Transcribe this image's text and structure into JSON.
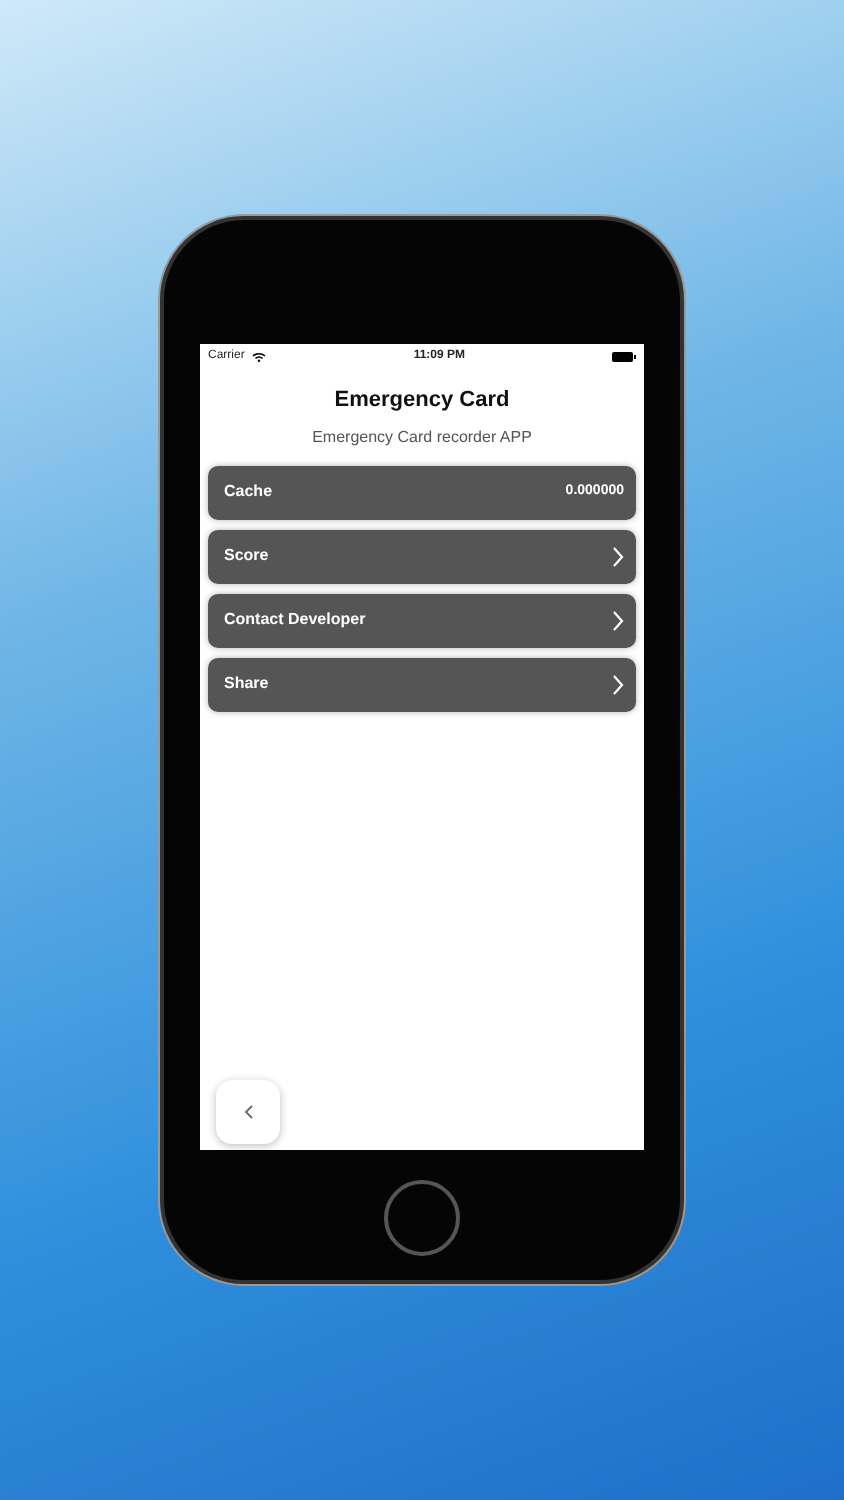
{
  "status_bar": {
    "carrier": "Carrier",
    "time": "11:09 PM"
  },
  "header": {
    "title": "Emergency Card",
    "subtitle": "Emergency Card recorder APP"
  },
  "rows": [
    {
      "label": "Cache",
      "kind": "value",
      "value": "0.000000"
    },
    {
      "label": "Score",
      "kind": "link"
    },
    {
      "label": "Contact Developer",
      "kind": "link"
    },
    {
      "label": "Share",
      "kind": "link"
    }
  ]
}
